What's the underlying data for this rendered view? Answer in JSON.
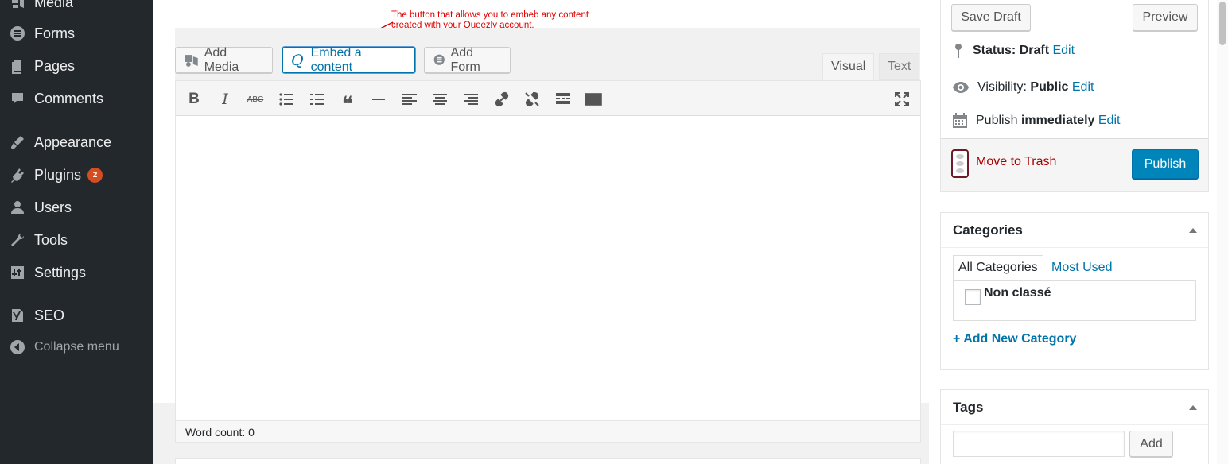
{
  "sidebar": {
    "items": [
      {
        "label": "Media",
        "icon": "media-icon"
      },
      {
        "label": "Forms",
        "icon": "forms-icon"
      },
      {
        "label": "Pages",
        "icon": "pages-icon"
      },
      {
        "label": "Comments",
        "icon": "comments-icon"
      },
      {
        "label": "Appearance",
        "icon": "appearance-icon"
      },
      {
        "label": "Plugins",
        "icon": "plugins-icon",
        "badge": "2"
      },
      {
        "label": "Users",
        "icon": "users-icon"
      },
      {
        "label": "Tools",
        "icon": "tools-icon"
      },
      {
        "label": "Settings",
        "icon": "settings-icon"
      },
      {
        "label": "SEO",
        "icon": "seo-icon"
      },
      {
        "label": "Collapse menu",
        "icon": "collapse-icon"
      }
    ]
  },
  "annotation": {
    "line1": "The button that allows you to embeb any content",
    "line2": "created with your Queezly account."
  },
  "media_buttons": {
    "add_media": "Add Media",
    "embed": "Embed a content",
    "embed_glyph": "Q",
    "add_form": "Add Form"
  },
  "editor_tabs": {
    "visual": "Visual",
    "text": "Text"
  },
  "toolbar": {
    "bold": "B",
    "italic": "I",
    "strike": "ABC",
    "quote": "❝"
  },
  "status": {
    "word_count": "Word count: 0"
  },
  "publish": {
    "save_draft": "Save Draft",
    "preview": "Preview",
    "status_label": "Status:",
    "status_value": "Draft",
    "visibility_label": "Visibility:",
    "visibility_value": "Public",
    "publish_label": "Publish",
    "publish_value": "immediately",
    "edit": "Edit",
    "trash": "Move to Trash",
    "publish_button": "Publish"
  },
  "categories": {
    "title": "Categories",
    "tab_all": "All Categories",
    "tab_used": "Most Used",
    "items": [
      "Non classé"
    ],
    "add_new": "+ Add New Category"
  },
  "tags": {
    "title": "Tags",
    "add_button": "Add"
  },
  "colors": {
    "sidebar_bg": "#23282d",
    "accent": "#0073aa",
    "publish_blue": "#0085ba",
    "badge": "#d54e21",
    "trash": "#a00000",
    "annotation": "#e00000"
  }
}
